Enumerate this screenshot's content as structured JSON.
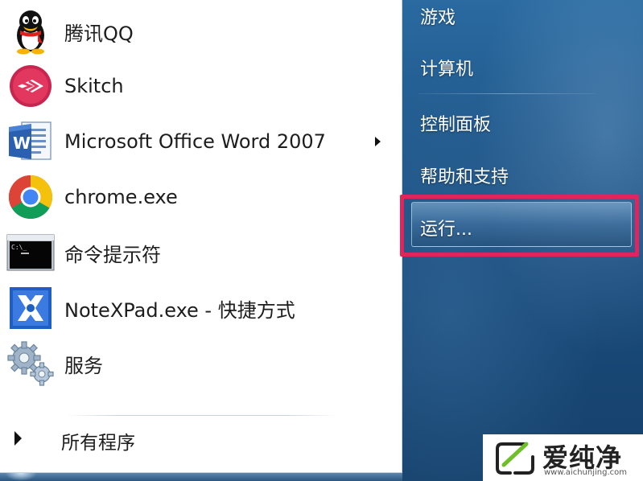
{
  "programs": [
    {
      "label": "腾讯QQ",
      "icon": "qq-penguin-icon"
    },
    {
      "label": "Skitch",
      "icon": "skitch-icon"
    },
    {
      "label": "Microsoft Office Word 2007",
      "icon": "word-icon",
      "has_submenu": true
    },
    {
      "label": "chrome.exe",
      "icon": "chrome-icon"
    },
    {
      "label": "命令提示符",
      "icon": "cmd-icon"
    },
    {
      "label": "NoteXPad.exe - 快捷方式",
      "icon": "notexpad-icon"
    },
    {
      "label": "服务",
      "icon": "gears-icon"
    }
  ],
  "all_programs": {
    "label": "所有程序"
  },
  "right_panel": {
    "games": "游戏",
    "computer": "计算机",
    "control_panel": "控制面板",
    "help": "帮助和支持",
    "run": "运行..."
  },
  "watermark": {
    "text": "爱纯净",
    "url": "www.aichunjing.com"
  },
  "colors": {
    "highlight_frame": "#e0245e",
    "right_panel_bg": "#1c4f80",
    "left_panel_bg": "#ffffff"
  }
}
